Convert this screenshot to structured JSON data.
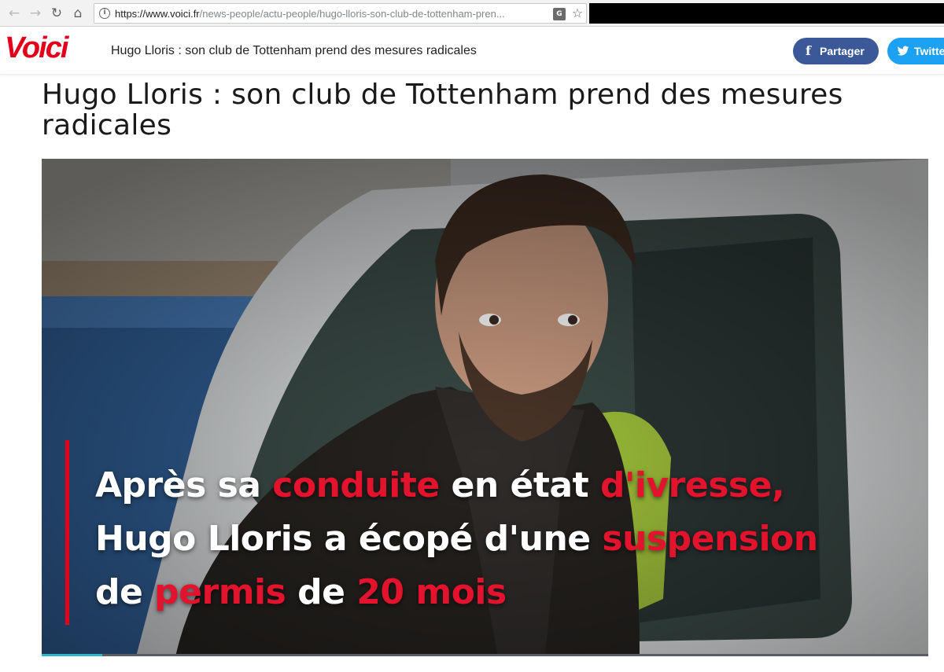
{
  "browser": {
    "back_icon": "back-arrow-icon",
    "forward_icon": "forward-arrow-icon",
    "reload_icon": "reload-icon",
    "home_icon": "home-icon",
    "url_host": "https://www.voici.fr",
    "url_path": "/news-people/actu-people/hugo-lloris-son-club-de-tottenham-pren..."
  },
  "header": {
    "logo": "Voici",
    "title": "Hugo Lloris : son club de Tottenham prend des mesures radicales",
    "share_facebook": "Partager",
    "share_twitter": "Twitter"
  },
  "article": {
    "title": "Hugo Lloris : son club de Tottenham prend des mesures radicales",
    "video": {
      "caption_lines": [
        [
          {
            "text": "Après sa ",
            "hl": false
          },
          {
            "text": "conduite",
            "hl": true
          },
          {
            "text": " en état ",
            "hl": false
          },
          {
            "text": "d'ivresse,",
            "hl": true
          }
        ],
        [
          {
            "text": "Hugo Lloris a écopé d'une ",
            "hl": false
          },
          {
            "text": "suspension",
            "hl": true
          }
        ],
        [
          {
            "text": "de ",
            "hl": false
          },
          {
            "text": "permis",
            "hl": true
          },
          {
            "text": " de ",
            "hl": false
          },
          {
            "text": "20 mois",
            "hl": true
          }
        ]
      ],
      "progress_fraction": 0.068
    }
  },
  "colors": {
    "brand_red": "#e3001b",
    "caption_highlight": "#e4132d",
    "facebook_blue": "#3b5998",
    "twitter_blue": "#1da1f2",
    "progress": "#35b6c8"
  }
}
